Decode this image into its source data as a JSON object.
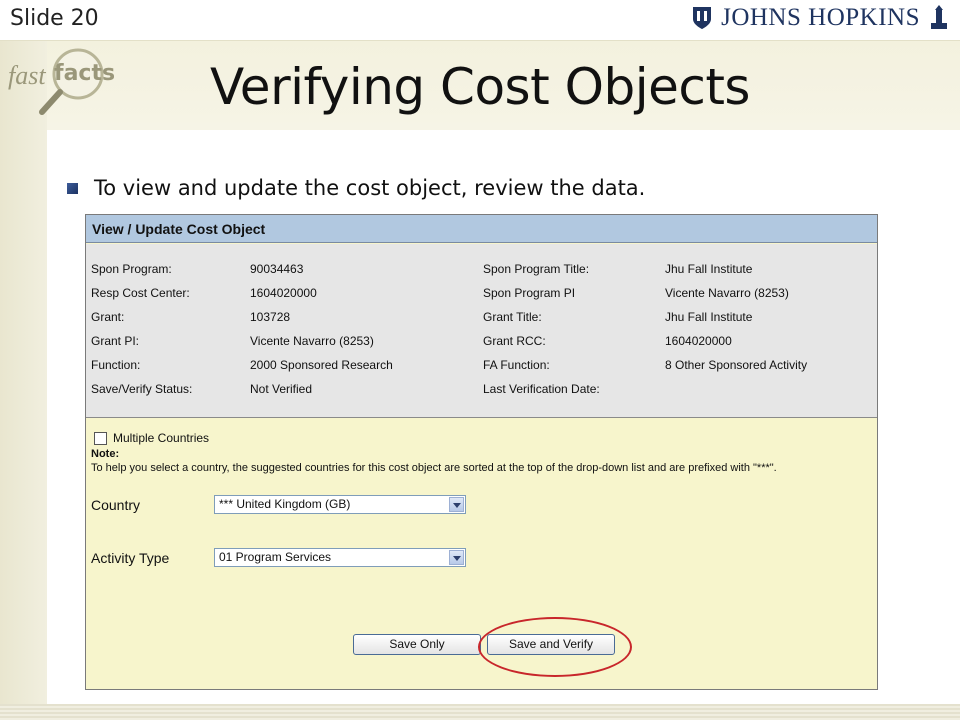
{
  "slide": {
    "number_label": "Slide 20",
    "logo_text": "JOHNS HOPKINS",
    "brand_badge": {
      "part1": "fast",
      "part2": "facts"
    },
    "title": "Verifying Cost Objects",
    "bullet": "To view and update the cost object, review the data."
  },
  "form": {
    "header": "View / Update Cost Object",
    "info_rows": [
      {
        "label_left": "Spon Program:",
        "value_left": "90034463",
        "label_right": "Spon Program Title:",
        "value_right": "Jhu Fall Institute"
      },
      {
        "label_left": "Resp Cost Center:",
        "value_left": "1604020000",
        "label_right": "Spon Program PI",
        "value_right": "Vicente Navarro  (8253)"
      },
      {
        "label_left": "Grant:",
        "value_left": "103728",
        "label_right": "Grant Title:",
        "value_right": "Jhu Fall Institute"
      },
      {
        "label_left": "Grant PI:",
        "value_left": "Vicente Navarro  (8253)",
        "label_right": "Grant RCC:",
        "value_right": "1604020000"
      },
      {
        "label_left": "Function:",
        "value_left": "2000 Sponsored Research",
        "label_right": "FA Function:",
        "value_right": "8 Other Sponsored Activity"
      },
      {
        "label_left": "Save/Verify Status:",
        "value_left": "Not Verified",
        "label_right": "Last Verification Date:",
        "value_right": ""
      }
    ],
    "multiple_countries_label": "Multiple Countries",
    "multiple_countries_checked": false,
    "note_label": "Note:",
    "note_text": "To help you select a country, the suggested countries for this cost object are sorted at the top of the drop-down list and are prefixed with \"***\".",
    "country_label": "Country",
    "country_value": "*** United Kingdom (GB)",
    "activity_label": "Activity Type",
    "activity_value": "01 Program Services",
    "save_only_label": "Save Only",
    "save_verify_label": "Save and Verify"
  },
  "colors": {
    "header_bg": "#b1c8e0",
    "info_bg": "#e6e6e6",
    "form_bg": "#f7f5cc",
    "highlight": "#c8262b"
  }
}
